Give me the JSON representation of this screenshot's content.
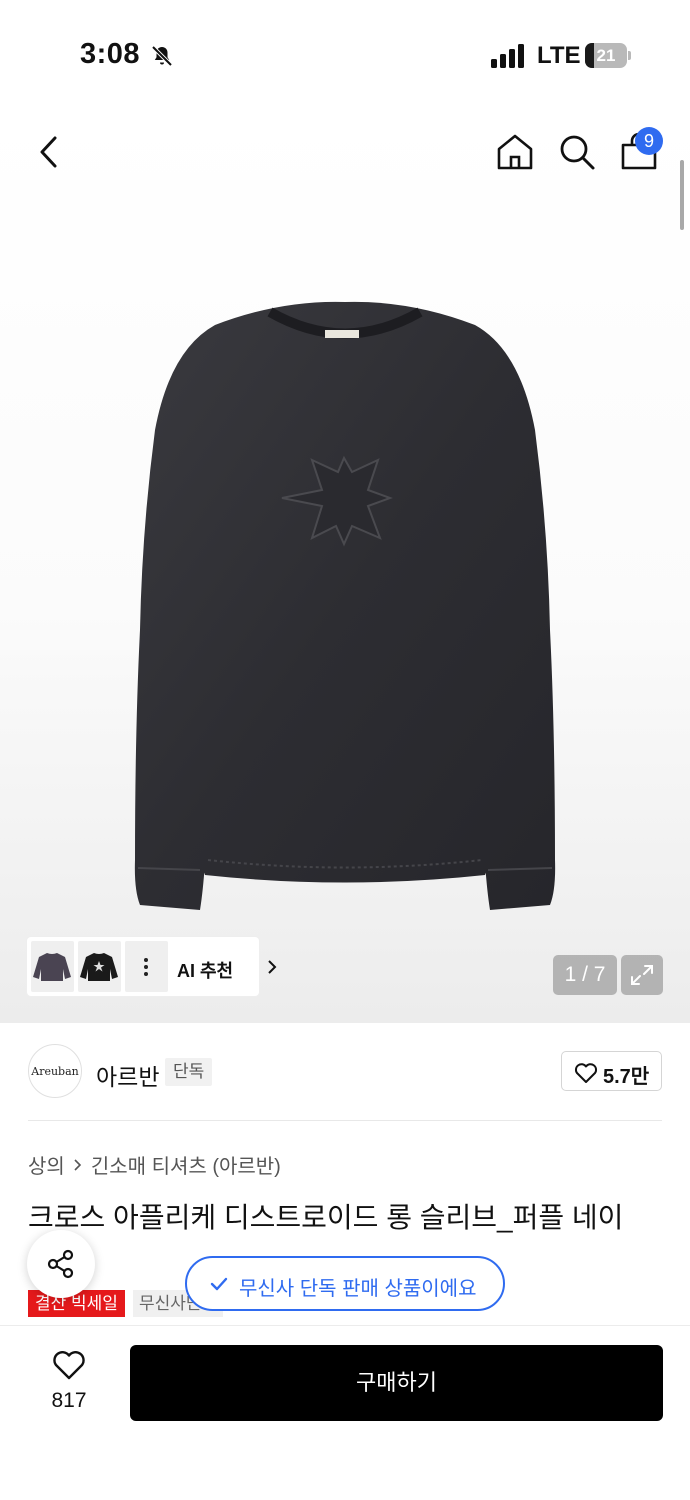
{
  "status_bar": {
    "time": "3:08",
    "network": "LTE",
    "battery": "21",
    "battery_level": 0.21
  },
  "nav": {
    "cart_badge": "9",
    "icons": [
      "back-icon",
      "home-icon",
      "search-icon",
      "cart-icon"
    ]
  },
  "gallery": {
    "counter": "1 / 7",
    "ai_recommend_label": "AI 추천",
    "thumb_icons": [
      "purple-sweater-thumb",
      "black-star-sweater-thumb",
      "more-dots-icon"
    ]
  },
  "brand": {
    "logo_text": "Areuban",
    "name": "아르반",
    "exclusive_badge": "단독",
    "like_count": "5.7만"
  },
  "breadcrumb": {
    "category": "상의",
    "subcategory": "긴소매 티셔츠 (아르반)"
  },
  "product": {
    "title": "크로스 아플리케 디스트로이드 롱 슬리브_퍼플 네이"
  },
  "tags": {
    "sale": "결산 빅세일",
    "exclusive": "무신사단독"
  },
  "toast": {
    "message": "무신사 단독 판매 상품이에요"
  },
  "bottom_bar": {
    "favorite_count": "817",
    "buy_label": "구매하기"
  },
  "colors": {
    "accent_blue": "#2f6bf0",
    "sale_red": "#e5191b",
    "buy_black": "#000000"
  }
}
